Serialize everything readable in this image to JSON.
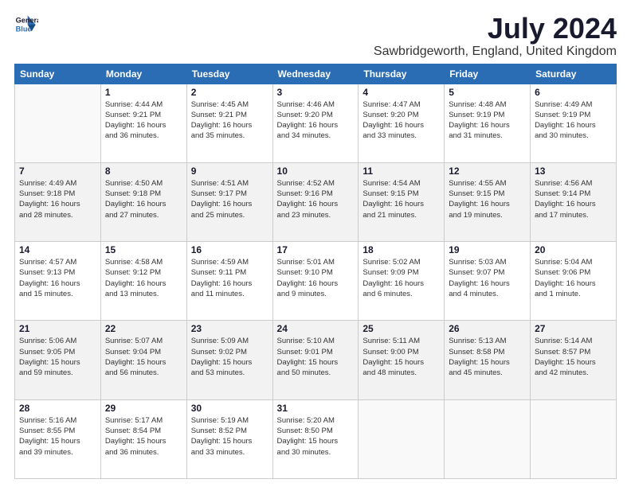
{
  "logo": {
    "line1": "General",
    "line2": "Blue"
  },
  "title": "July 2024",
  "location": "Sawbridgeworth, England, United Kingdom",
  "days_header": [
    "Sunday",
    "Monday",
    "Tuesday",
    "Wednesday",
    "Thursday",
    "Friday",
    "Saturday"
  ],
  "weeks": [
    [
      {
        "day": "",
        "lines": []
      },
      {
        "day": "1",
        "lines": [
          "Sunrise: 4:44 AM",
          "Sunset: 9:21 PM",
          "Daylight: 16 hours",
          "and 36 minutes."
        ]
      },
      {
        "day": "2",
        "lines": [
          "Sunrise: 4:45 AM",
          "Sunset: 9:21 PM",
          "Daylight: 16 hours",
          "and 35 minutes."
        ]
      },
      {
        "day": "3",
        "lines": [
          "Sunrise: 4:46 AM",
          "Sunset: 9:20 PM",
          "Daylight: 16 hours",
          "and 34 minutes."
        ]
      },
      {
        "day": "4",
        "lines": [
          "Sunrise: 4:47 AM",
          "Sunset: 9:20 PM",
          "Daylight: 16 hours",
          "and 33 minutes."
        ]
      },
      {
        "day": "5",
        "lines": [
          "Sunrise: 4:48 AM",
          "Sunset: 9:19 PM",
          "Daylight: 16 hours",
          "and 31 minutes."
        ]
      },
      {
        "day": "6",
        "lines": [
          "Sunrise: 4:49 AM",
          "Sunset: 9:19 PM",
          "Daylight: 16 hours",
          "and 30 minutes."
        ]
      }
    ],
    [
      {
        "day": "7",
        "lines": [
          "Sunrise: 4:49 AM",
          "Sunset: 9:18 PM",
          "Daylight: 16 hours",
          "and 28 minutes."
        ]
      },
      {
        "day": "8",
        "lines": [
          "Sunrise: 4:50 AM",
          "Sunset: 9:18 PM",
          "Daylight: 16 hours",
          "and 27 minutes."
        ]
      },
      {
        "day": "9",
        "lines": [
          "Sunrise: 4:51 AM",
          "Sunset: 9:17 PM",
          "Daylight: 16 hours",
          "and 25 minutes."
        ]
      },
      {
        "day": "10",
        "lines": [
          "Sunrise: 4:52 AM",
          "Sunset: 9:16 PM",
          "Daylight: 16 hours",
          "and 23 minutes."
        ]
      },
      {
        "day": "11",
        "lines": [
          "Sunrise: 4:54 AM",
          "Sunset: 9:15 PM",
          "Daylight: 16 hours",
          "and 21 minutes."
        ]
      },
      {
        "day": "12",
        "lines": [
          "Sunrise: 4:55 AM",
          "Sunset: 9:15 PM",
          "Daylight: 16 hours",
          "and 19 minutes."
        ]
      },
      {
        "day": "13",
        "lines": [
          "Sunrise: 4:56 AM",
          "Sunset: 9:14 PM",
          "Daylight: 16 hours",
          "and 17 minutes."
        ]
      }
    ],
    [
      {
        "day": "14",
        "lines": [
          "Sunrise: 4:57 AM",
          "Sunset: 9:13 PM",
          "Daylight: 16 hours",
          "and 15 minutes."
        ]
      },
      {
        "day": "15",
        "lines": [
          "Sunrise: 4:58 AM",
          "Sunset: 9:12 PM",
          "Daylight: 16 hours",
          "and 13 minutes."
        ]
      },
      {
        "day": "16",
        "lines": [
          "Sunrise: 4:59 AM",
          "Sunset: 9:11 PM",
          "Daylight: 16 hours",
          "and 11 minutes."
        ]
      },
      {
        "day": "17",
        "lines": [
          "Sunrise: 5:01 AM",
          "Sunset: 9:10 PM",
          "Daylight: 16 hours",
          "and 9 minutes."
        ]
      },
      {
        "day": "18",
        "lines": [
          "Sunrise: 5:02 AM",
          "Sunset: 9:09 PM",
          "Daylight: 16 hours",
          "and 6 minutes."
        ]
      },
      {
        "day": "19",
        "lines": [
          "Sunrise: 5:03 AM",
          "Sunset: 9:07 PM",
          "Daylight: 16 hours",
          "and 4 minutes."
        ]
      },
      {
        "day": "20",
        "lines": [
          "Sunrise: 5:04 AM",
          "Sunset: 9:06 PM",
          "Daylight: 16 hours",
          "and 1 minute."
        ]
      }
    ],
    [
      {
        "day": "21",
        "lines": [
          "Sunrise: 5:06 AM",
          "Sunset: 9:05 PM",
          "Daylight: 15 hours",
          "and 59 minutes."
        ]
      },
      {
        "day": "22",
        "lines": [
          "Sunrise: 5:07 AM",
          "Sunset: 9:04 PM",
          "Daylight: 15 hours",
          "and 56 minutes."
        ]
      },
      {
        "day": "23",
        "lines": [
          "Sunrise: 5:09 AM",
          "Sunset: 9:02 PM",
          "Daylight: 15 hours",
          "and 53 minutes."
        ]
      },
      {
        "day": "24",
        "lines": [
          "Sunrise: 5:10 AM",
          "Sunset: 9:01 PM",
          "Daylight: 15 hours",
          "and 50 minutes."
        ]
      },
      {
        "day": "25",
        "lines": [
          "Sunrise: 5:11 AM",
          "Sunset: 9:00 PM",
          "Daylight: 15 hours",
          "and 48 minutes."
        ]
      },
      {
        "day": "26",
        "lines": [
          "Sunrise: 5:13 AM",
          "Sunset: 8:58 PM",
          "Daylight: 15 hours",
          "and 45 minutes."
        ]
      },
      {
        "day": "27",
        "lines": [
          "Sunrise: 5:14 AM",
          "Sunset: 8:57 PM",
          "Daylight: 15 hours",
          "and 42 minutes."
        ]
      }
    ],
    [
      {
        "day": "28",
        "lines": [
          "Sunrise: 5:16 AM",
          "Sunset: 8:55 PM",
          "Daylight: 15 hours",
          "and 39 minutes."
        ]
      },
      {
        "day": "29",
        "lines": [
          "Sunrise: 5:17 AM",
          "Sunset: 8:54 PM",
          "Daylight: 15 hours",
          "and 36 minutes."
        ]
      },
      {
        "day": "30",
        "lines": [
          "Sunrise: 5:19 AM",
          "Sunset: 8:52 PM",
          "Daylight: 15 hours",
          "and 33 minutes."
        ]
      },
      {
        "day": "31",
        "lines": [
          "Sunrise: 5:20 AM",
          "Sunset: 8:50 PM",
          "Daylight: 15 hours",
          "and 30 minutes."
        ]
      },
      {
        "day": "",
        "lines": []
      },
      {
        "day": "",
        "lines": []
      },
      {
        "day": "",
        "lines": []
      }
    ]
  ]
}
